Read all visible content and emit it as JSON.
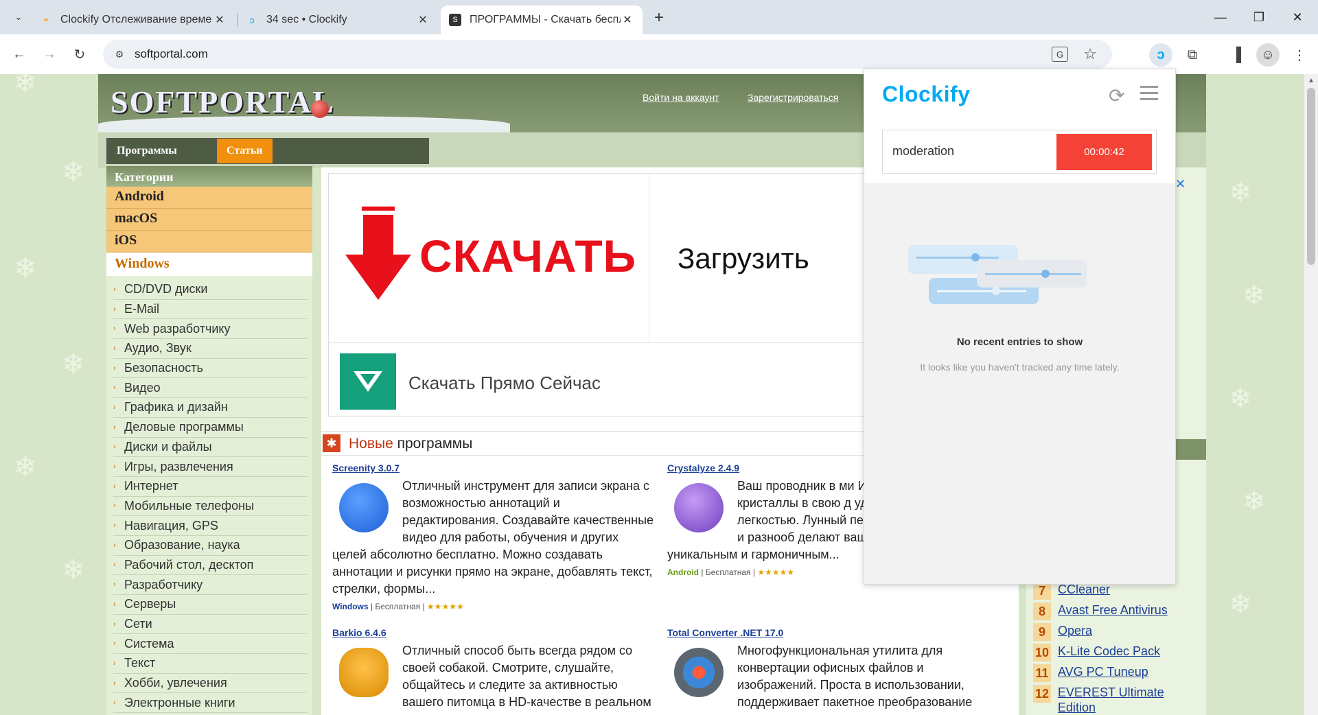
{
  "browser": {
    "tabs": [
      {
        "title": "Clockify Отслеживание време",
        "active": false
      },
      {
        "title": "34 sec • Clockify",
        "active": false
      },
      {
        "title": "ПРОГРАММЫ - Скачать беспл",
        "active": true
      }
    ],
    "url": "softportal.com"
  },
  "site": {
    "logo": "SOFTPORTAL",
    "login": "Войти на аккаунт",
    "register": "Зарегистрироваться",
    "nav": {
      "programs": "Программы",
      "articles": "Статьи"
    },
    "sidebar": {
      "heading": "Категории",
      "os": [
        "Android",
        "macOS",
        "iOS"
      ],
      "windows": "Windows",
      "items": [
        "CD/DVD диски",
        "E-Mail",
        "Web разработчику",
        "Аудио, Звук",
        "Безопасность",
        "Видео",
        "Графика и дизайн",
        "Деловые программы",
        "Диски и файлы",
        "Игры, развлечения",
        "Интернет",
        "Мобильные телефоны",
        "Навигация, GPS",
        "Образование, наука",
        "Рабочий стол, десктоп",
        "Разработчику",
        "Серверы",
        "Сети",
        "Система",
        "Текст",
        "Хобби, увлечения",
        "Электронные книги"
      ]
    },
    "ad": {
      "skachat": "СКАЧАТЬ",
      "zagruzit": "Загрузить",
      "cta": "Скачать Прямо Сейчас"
    },
    "new_section": {
      "word1": "Новые",
      "word2": "программы"
    },
    "programs": [
      {
        "name": "Screenity 3.0.7",
        "desc": "Отличный инструмент для записи экрана с возможностью аннотаций и редактирования. Создавайте качественные видео для работы, обучения и других целей абсолютно бесплатно. Можно создавать аннотации и рисунки прямо на экране, добавлять текст, стрелки, формы...",
        "platform": "Windows",
        "license": "Бесплатная",
        "stars": "★★★★★",
        "icon_color": "#2f7ce8"
      },
      {
        "name": "Crystalyze 2.4.9",
        "desc": "Ваш проводник в ми Исследуйте, выбира кристаллы в свою д удобством и легкостью. Лунный персональные заметки и разнооб делают ваш путь с Crystalyze уникальным и гармоничным...",
        "platform": "Android",
        "license": "Бесплатная",
        "stars": "★★★★★",
        "icon_color": "#8a5ad2"
      },
      {
        "name": "Barkio 6.4.6",
        "desc": "Отличный способ быть всегда рядом со своей собакой. Смотрите, слушайте, общайтесь и следите за активностью вашего питомца в HD-качестве в реальном времени",
        "icon_color": "#f0a81f"
      },
      {
        "name": "Total Converter .NET 17.0",
        "desc": "Многофункциональная утилита для конвертации офисных файлов и изображений. Проста в использовании, поддерживает пакетное преобразование",
        "icon_color": "#5c6670"
      }
    ],
    "top": [
      {
        "num": "7",
        "name": "CCleaner"
      },
      {
        "num": "8",
        "name": "Avast Free Antivirus"
      },
      {
        "num": "9",
        "name": "Opera"
      },
      {
        "num": "10",
        "name": "K-Lite Codec Pack"
      },
      {
        "num": "11",
        "name": "AVG PC Tuneup"
      },
      {
        "num": "12",
        "name": "EVEREST Ultimate Edition"
      }
    ]
  },
  "clockify": {
    "logo": "Clockify",
    "description": "moderation",
    "timer": "00:00:42",
    "empty_title": "No recent entries to show",
    "empty_sub": "It looks like you haven't tracked any time lately.",
    "accent": "#03a9f4",
    "timer_color": "#f44336"
  }
}
